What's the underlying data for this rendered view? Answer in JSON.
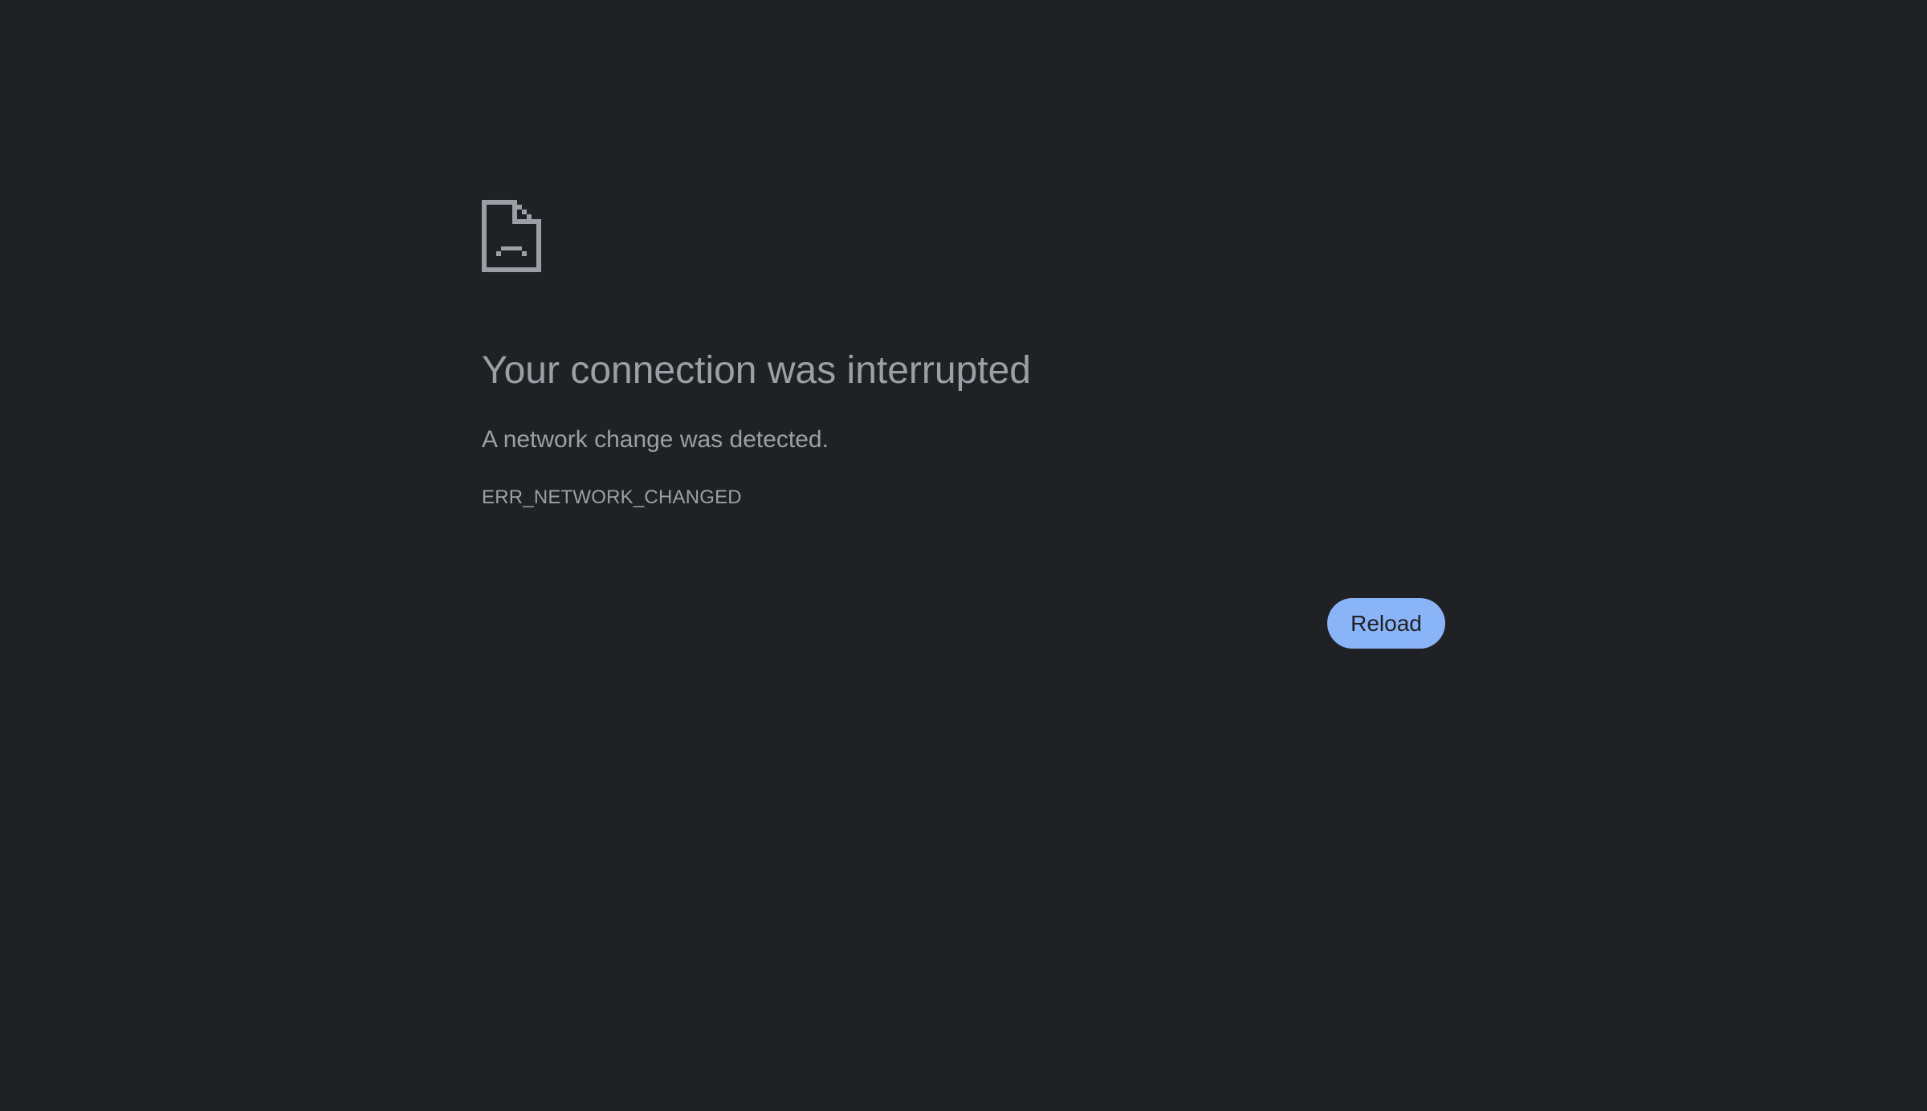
{
  "page": {
    "background_color": "#202124",
    "text_color": "#9aa0a6",
    "accent_color": "#8ab4f8"
  },
  "error": {
    "icon": "sad-document-icon",
    "title": "Your connection was interrupted",
    "message": "A network change was detected.",
    "code": "ERR_NETWORK_CHANGED"
  },
  "actions": {
    "reload_label": "Reload"
  }
}
